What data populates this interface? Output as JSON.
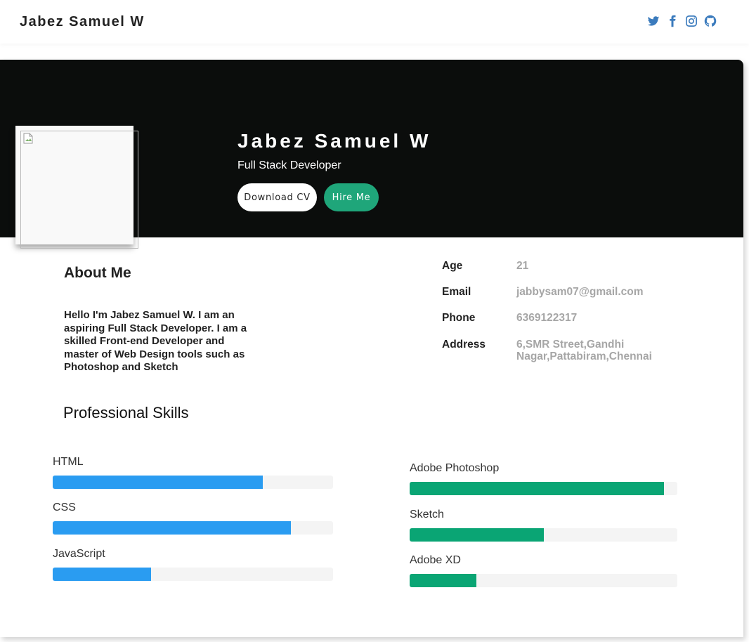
{
  "navbar": {
    "brand": "Jabez Samuel W",
    "social": [
      "twitter-icon",
      "facebook-icon",
      "instagram-icon",
      "github-icon"
    ],
    "icon_color": "#3b7bbd"
  },
  "hero": {
    "name": "Jabez Samuel W",
    "role": "Full Stack Developer",
    "download_cv_label": "Download CV",
    "hire_me_label": "Hire Me",
    "background": "#0b0d0c",
    "accent": "#1fa67a"
  },
  "about": {
    "title": "About Me",
    "text": "Hello I'm Jabez Samuel W. I am an aspiring Full Stack Developer. I am a skilled Front-end Developer and master of Web Design tools such as Photoshop and Sketch"
  },
  "info": [
    {
      "label": "Age",
      "value": "21"
    },
    {
      "label": "Email",
      "value": "jabbysam07@gmail.com"
    },
    {
      "label": "Phone",
      "value": "6369122317"
    },
    {
      "label": "Address",
      "value": "6,SMR Street,Gandhi Nagar,Pattabiram,Chennai"
    }
  ],
  "skills": {
    "title": "Professional Skills",
    "left": [
      {
        "name": "HTML",
        "percent": 75,
        "color": "#2a9cf1"
      },
      {
        "name": "CSS",
        "percent": 85,
        "color": "#2a9cf1"
      },
      {
        "name": "JavaScript",
        "percent": 35,
        "color": "#2a9cf1"
      }
    ],
    "right": [
      {
        "name": "Adobe Photoshop",
        "percent": 95,
        "color": "#0aa574"
      },
      {
        "name": "Sketch",
        "percent": 50,
        "color": "#0aa574"
      },
      {
        "name": "Adobe XD",
        "percent": 25,
        "color": "#0aa574"
      }
    ]
  }
}
